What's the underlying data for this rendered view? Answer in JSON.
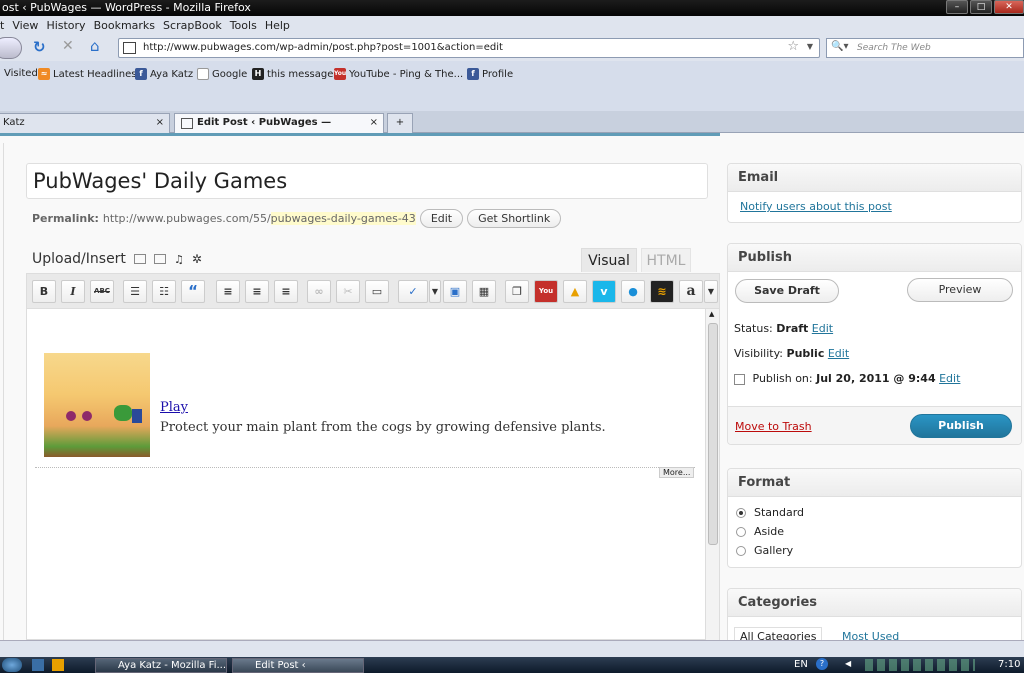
{
  "window": {
    "title": "ost ‹ PubWages — WordPress - Mozilla Firefox"
  },
  "menu": [
    "t",
    "View",
    "History",
    "Bookmarks",
    "ScrapBook",
    "Tools",
    "Help"
  ],
  "nav": {
    "url": "http://www.pubwages.com/wp-admin/post.php?post=1001&action=edit",
    "search_placeholder": "Search The Web"
  },
  "bookmarks": [
    {
      "label": "Visited",
      "icon": "page-icon"
    },
    {
      "label": "Latest Headlines",
      "icon": "rss-icon"
    },
    {
      "label": "Aya Katz",
      "icon": "facebook-icon"
    },
    {
      "label": "Google",
      "icon": "page-icon"
    },
    {
      "label": "this message",
      "icon": "hubpages-icon"
    },
    {
      "label": "YouTube - Ping & The...",
      "icon": "youtube-icon"
    },
    {
      "label": "Profile",
      "icon": "facebook-icon"
    }
  ],
  "tabs": [
    {
      "label": "Katz"
    },
    {
      "label": "Edit Post ‹ PubWages — WordPress"
    }
  ],
  "post": {
    "title": "PubWages' Daily Games",
    "permalink_label": "Permalink:",
    "permalink_base": "http://www.pubwages.com/55/",
    "permalink_slug": "pubwages-daily-games-43",
    "edit_btn": "Edit",
    "shortlink_btn": "Get Shortlink",
    "upload_label": "Upload/Insert",
    "tab_visual": "Visual",
    "tab_html": "HTML",
    "play_link": "Play",
    "description": "Protect your main plant from the cogs by growing defensive plants.",
    "more_tag": "More..."
  },
  "toolbar": {
    "bold": "B",
    "italic": "I",
    "strike": "ABC",
    "quote": "“"
  },
  "email_box": {
    "title": "Email",
    "link": "Notify users about this post"
  },
  "publish_box": {
    "title": "Publish",
    "save_draft": "Save Draft",
    "preview": "Preview",
    "status_label": "Status:",
    "status_value": "Draft",
    "visibility_label": "Visibility:",
    "visibility_value": "Public",
    "publish_on_label": "Publish on:",
    "publish_on_value": "Jul 20, 2011 @ 9:44",
    "edit": "Edit",
    "trash": "Move to Trash",
    "publish": "Publish"
  },
  "format_box": {
    "title": "Format",
    "options": [
      "Standard",
      "Aside",
      "Gallery"
    ],
    "selected": "Standard"
  },
  "categories_box": {
    "title": "Categories",
    "tab_all": "All Categories",
    "tab_used": "Most Used"
  },
  "taskbar": {
    "task1": "Aya Katz - Mozilla Fi...",
    "task2": "Edit Post ‹ PubWage...",
    "lang": "EN",
    "time": "7:10"
  },
  "colors": {
    "wp_blue": "#21759b",
    "publish_btn": "#2a95c5",
    "trash_red": "#bc0b0b"
  }
}
